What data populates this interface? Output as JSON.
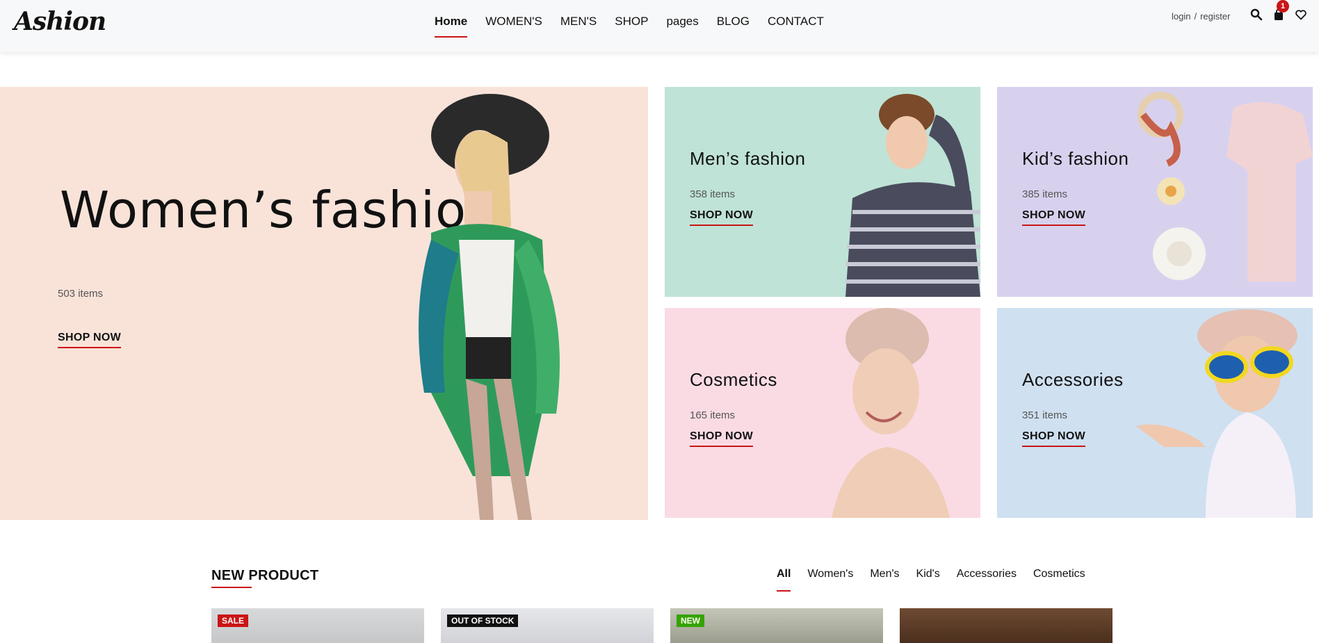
{
  "header": {
    "logo": "Ashion",
    "nav": [
      {
        "label": "Home",
        "active": true
      },
      {
        "label": "WOMEN'S",
        "active": false
      },
      {
        "label": "MEN'S",
        "active": false
      },
      {
        "label": "SHOP",
        "active": false
      },
      {
        "label": "pages",
        "active": false
      },
      {
        "label": "BLOG",
        "active": false
      },
      {
        "label": "CONTACT",
        "active": false
      }
    ],
    "login": "login",
    "separator": "/",
    "register": "register",
    "cart_count": "1",
    "icons": [
      "search-icon",
      "shopping-bag-icon",
      "heart-icon"
    ],
    "accent": "#ca1515"
  },
  "hero": {
    "women": {
      "title": "Women’s fashion",
      "items": "503 items",
      "cta": "SHOP NOW",
      "bg": "#f9e3d9"
    },
    "categories": [
      {
        "title": "Men’s fashion",
        "items": "358 items",
        "cta": "SHOP NOW",
        "bg": "#bfe3d6"
      },
      {
        "title": "Kid’s fashion",
        "items": "385 items",
        "cta": "SHOP NOW",
        "bg": "#d8d1ee"
      },
      {
        "title": "Cosmetics",
        "items": "165 items",
        "cta": "SHOP NOW",
        "bg": "#fadbe4"
      },
      {
        "title": "Accessories",
        "items": "351 items",
        "cta": "SHOP NOW",
        "bg": "#cfe0f1"
      }
    ]
  },
  "new_product": {
    "title_part1": "NEW",
    "title_part2": "PRODUCT",
    "filters": [
      {
        "label": "All",
        "active": true
      },
      {
        "label": "Women's",
        "active": false
      },
      {
        "label": "Men's",
        "active": false
      },
      {
        "label": "Kid's",
        "active": false
      },
      {
        "label": "Accessories",
        "active": false
      },
      {
        "label": "Cosmetics",
        "active": false
      }
    ],
    "products": [
      {
        "label": "SALE",
        "label_color": "#ca1515"
      },
      {
        "label": "OUT OF STOCK",
        "label_color": "#111111"
      },
      {
        "label": "NEW",
        "label_color": "#36a300"
      },
      {
        "label": "",
        "label_color": ""
      }
    ]
  }
}
